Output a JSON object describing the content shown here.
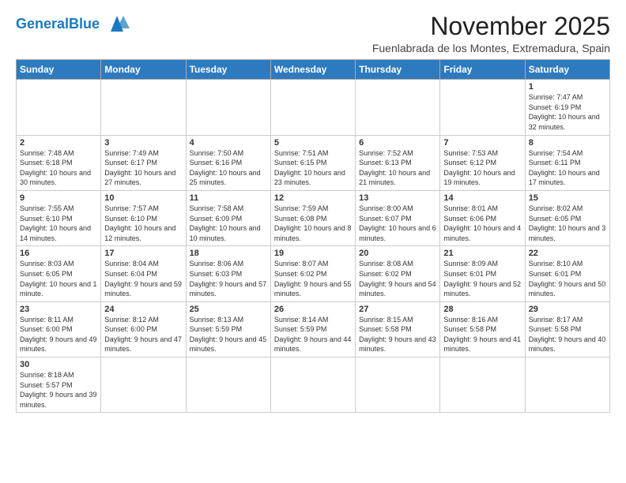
{
  "header": {
    "logo_general": "General",
    "logo_blue": "Blue",
    "month_title": "November 2025",
    "location": "Fuenlabrada de los Montes, Extremadura, Spain"
  },
  "days_of_week": [
    "Sunday",
    "Monday",
    "Tuesday",
    "Wednesday",
    "Thursday",
    "Friday",
    "Saturday"
  ],
  "weeks": [
    [
      {
        "day": "",
        "info": ""
      },
      {
        "day": "",
        "info": ""
      },
      {
        "day": "",
        "info": ""
      },
      {
        "day": "",
        "info": ""
      },
      {
        "day": "",
        "info": ""
      },
      {
        "day": "",
        "info": ""
      },
      {
        "day": "1",
        "info": "Sunrise: 7:47 AM\nSunset: 6:19 PM\nDaylight: 10 hours and 32 minutes."
      }
    ],
    [
      {
        "day": "2",
        "info": "Sunrise: 7:48 AM\nSunset: 6:18 PM\nDaylight: 10 hours and 30 minutes."
      },
      {
        "day": "3",
        "info": "Sunrise: 7:49 AM\nSunset: 6:17 PM\nDaylight: 10 hours and 27 minutes."
      },
      {
        "day": "4",
        "info": "Sunrise: 7:50 AM\nSunset: 6:16 PM\nDaylight: 10 hours and 25 minutes."
      },
      {
        "day": "5",
        "info": "Sunrise: 7:51 AM\nSunset: 6:15 PM\nDaylight: 10 hours and 23 minutes."
      },
      {
        "day": "6",
        "info": "Sunrise: 7:52 AM\nSunset: 6:13 PM\nDaylight: 10 hours and 21 minutes."
      },
      {
        "day": "7",
        "info": "Sunrise: 7:53 AM\nSunset: 6:12 PM\nDaylight: 10 hours and 19 minutes."
      },
      {
        "day": "8",
        "info": "Sunrise: 7:54 AM\nSunset: 6:11 PM\nDaylight: 10 hours and 17 minutes."
      }
    ],
    [
      {
        "day": "9",
        "info": "Sunrise: 7:55 AM\nSunset: 6:10 PM\nDaylight: 10 hours and 14 minutes."
      },
      {
        "day": "10",
        "info": "Sunrise: 7:57 AM\nSunset: 6:10 PM\nDaylight: 10 hours and 12 minutes."
      },
      {
        "day": "11",
        "info": "Sunrise: 7:58 AM\nSunset: 6:09 PM\nDaylight: 10 hours and 10 minutes."
      },
      {
        "day": "12",
        "info": "Sunrise: 7:59 AM\nSunset: 6:08 PM\nDaylight: 10 hours and 8 minutes."
      },
      {
        "day": "13",
        "info": "Sunrise: 8:00 AM\nSunset: 6:07 PM\nDaylight: 10 hours and 6 minutes."
      },
      {
        "day": "14",
        "info": "Sunrise: 8:01 AM\nSunset: 6:06 PM\nDaylight: 10 hours and 4 minutes."
      },
      {
        "day": "15",
        "info": "Sunrise: 8:02 AM\nSunset: 6:05 PM\nDaylight: 10 hours and 3 minutes."
      }
    ],
    [
      {
        "day": "16",
        "info": "Sunrise: 8:03 AM\nSunset: 6:05 PM\nDaylight: 10 hours and 1 minute."
      },
      {
        "day": "17",
        "info": "Sunrise: 8:04 AM\nSunset: 6:04 PM\nDaylight: 9 hours and 59 minutes."
      },
      {
        "day": "18",
        "info": "Sunrise: 8:06 AM\nSunset: 6:03 PM\nDaylight: 9 hours and 57 minutes."
      },
      {
        "day": "19",
        "info": "Sunrise: 8:07 AM\nSunset: 6:02 PM\nDaylight: 9 hours and 55 minutes."
      },
      {
        "day": "20",
        "info": "Sunrise: 8:08 AM\nSunset: 6:02 PM\nDaylight: 9 hours and 54 minutes."
      },
      {
        "day": "21",
        "info": "Sunrise: 8:09 AM\nSunset: 6:01 PM\nDaylight: 9 hours and 52 minutes."
      },
      {
        "day": "22",
        "info": "Sunrise: 8:10 AM\nSunset: 6:01 PM\nDaylight: 9 hours and 50 minutes."
      }
    ],
    [
      {
        "day": "23",
        "info": "Sunrise: 8:11 AM\nSunset: 6:00 PM\nDaylight: 9 hours and 49 minutes."
      },
      {
        "day": "24",
        "info": "Sunrise: 8:12 AM\nSunset: 6:00 PM\nDaylight: 9 hours and 47 minutes."
      },
      {
        "day": "25",
        "info": "Sunrise: 8:13 AM\nSunset: 5:59 PM\nDaylight: 9 hours and 45 minutes."
      },
      {
        "day": "26",
        "info": "Sunrise: 8:14 AM\nSunset: 5:59 PM\nDaylight: 9 hours and 44 minutes."
      },
      {
        "day": "27",
        "info": "Sunrise: 8:15 AM\nSunset: 5:58 PM\nDaylight: 9 hours and 43 minutes."
      },
      {
        "day": "28",
        "info": "Sunrise: 8:16 AM\nSunset: 5:58 PM\nDaylight: 9 hours and 41 minutes."
      },
      {
        "day": "29",
        "info": "Sunrise: 8:17 AM\nSunset: 5:58 PM\nDaylight: 9 hours and 40 minutes."
      }
    ],
    [
      {
        "day": "30",
        "info": "Sunrise: 8:18 AM\nSunset: 5:57 PM\nDaylight: 9 hours and 39 minutes."
      },
      {
        "day": "",
        "info": ""
      },
      {
        "day": "",
        "info": ""
      },
      {
        "day": "",
        "info": ""
      },
      {
        "day": "",
        "info": ""
      },
      {
        "day": "",
        "info": ""
      },
      {
        "day": "",
        "info": ""
      }
    ]
  ]
}
